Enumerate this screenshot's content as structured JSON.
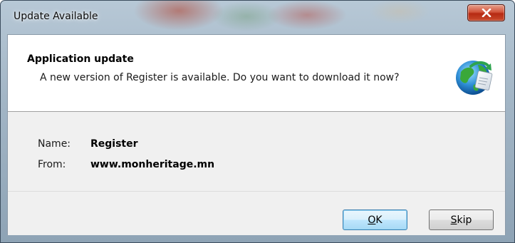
{
  "window": {
    "title": "Update Available"
  },
  "header": {
    "title": "Application update",
    "description": "A new version of Register is available. Do you want to download it now?"
  },
  "details": [
    {
      "label": "Name:",
      "value": "Register"
    },
    {
      "label": "From:",
      "value": "www.monheritage.mn"
    }
  ],
  "buttons": {
    "ok_accel": "O",
    "ok_rest": "K",
    "skip_accel": "S",
    "skip_rest": "kip"
  },
  "icons": {
    "close": "close-icon",
    "update": "globe-update-icon"
  },
  "colors": {
    "close_button": "#c94a2c",
    "default_button_border": "#3c7fb1",
    "header_background": "#ffffff",
    "body_background": "#f0f0f0"
  }
}
